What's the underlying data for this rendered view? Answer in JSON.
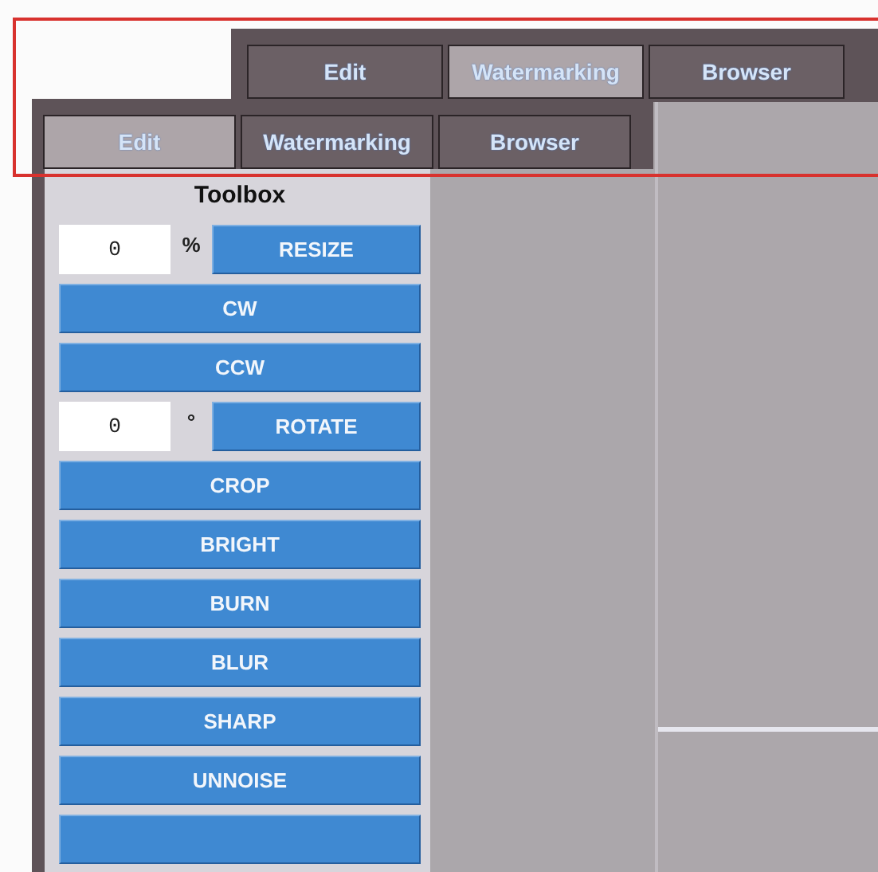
{
  "back_window": {
    "tabs": [
      {
        "label": "Edit",
        "selected": false
      },
      {
        "label": "Watermarking",
        "selected": true
      },
      {
        "label": "Browser",
        "selected": false
      }
    ]
  },
  "front_window": {
    "tabs": [
      {
        "label": "Edit",
        "selected": true
      },
      {
        "label": "Watermarking",
        "selected": false
      },
      {
        "label": "Browser",
        "selected": false
      }
    ],
    "toolbox": {
      "title": "Toolbox",
      "rows": [
        {
          "kind": "field",
          "value": "0",
          "unit": "%",
          "button": "RESIZE"
        },
        {
          "kind": "button",
          "label": "CW"
        },
        {
          "kind": "button",
          "label": "CCW"
        },
        {
          "kind": "field",
          "value": "0",
          "unit": "°",
          "button": "ROTATE"
        },
        {
          "kind": "button",
          "label": "CROP"
        },
        {
          "kind": "button",
          "label": "BRIGHT"
        },
        {
          "kind": "button",
          "label": "BURN"
        },
        {
          "kind": "button",
          "label": "BLUR"
        },
        {
          "kind": "button",
          "label": "SHARP"
        },
        {
          "kind": "button",
          "label": "UNNOISE"
        },
        {
          "kind": "button"
        }
      ]
    }
  }
}
